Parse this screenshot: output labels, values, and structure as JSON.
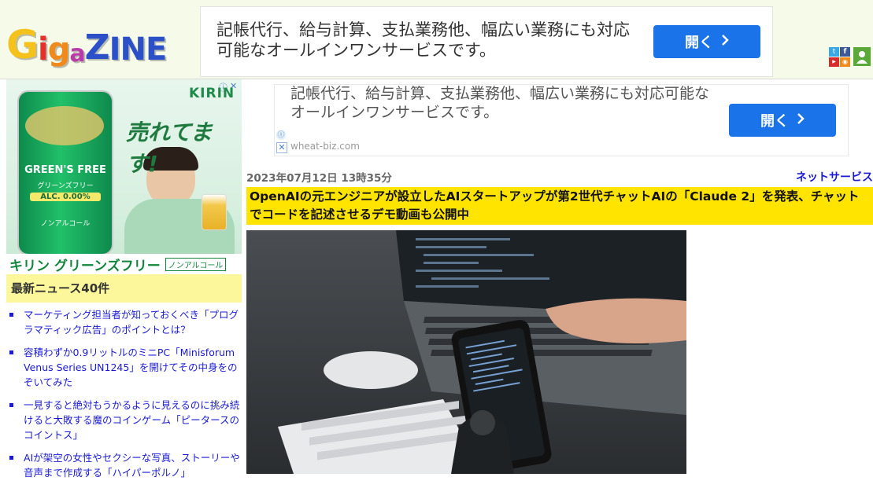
{
  "header": {
    "logo_text": "GigaZINE",
    "top_ad": {
      "text": "記帳代行、給与計算、支払業務他、幅広い業務にも対応可能なオールインワンサービスです。",
      "button_label": "開く",
      "info_glyph": "ⓘ",
      "close_glyph": "✕"
    },
    "social_icons": [
      "twitter-icon",
      "facebook-icon",
      "youtube-icon",
      "rss-icon",
      "user-icon"
    ]
  },
  "sidebar": {
    "kirin_ad": {
      "brand": "KIRIN",
      "can_line1": "GREEN'S FREE",
      "can_line2": "グリーンズフリー",
      "can_alc": "ALC. 0.00%",
      "can_bottom": "ノンアルコール",
      "headline": "売れてます!",
      "banner_main": "キリン グリーンズフリー",
      "banner_tag": "ノンアルコール",
      "info_glyph": "ⓘ",
      "close_glyph": "✕"
    },
    "news_heading": "最新ニュース40件",
    "news_items": [
      "マーケティング担当者が知っておくべき「プログラマティック広告」のポイントとは？",
      "容積わずか0.9リットルのミニPC「Minisforum Venus Series UN1245」を開けてその中身をのぞいてみた",
      "一見すると絶対もうかるように見えるのに挑み続けると大敗する魔のコインゲーム「ピータースのコイントス」",
      "AIが架空の女性やセクシーな写真、ストーリーや音声まで作成する「ハイパーポルノ」"
    ]
  },
  "main": {
    "ad": {
      "text": "記帳代行、給与計算、支払業務他、幅広い業務にも対応可能なオールインワンサービスです。",
      "button_label": "開く",
      "domain": "wheat-biz.com",
      "info_glyph": "ⓘ",
      "close_glyph": "✕"
    },
    "date": "2023年07月12日 13時35分",
    "category": "ネットサービス",
    "title": "OpenAIの元エンジニアが設立したAIスタートアップが第2世代チャットAIの「Claude 2」を発表、チャットでコードを記述させるデモ動画も公開中"
  },
  "colors": {
    "header_bg": "#f6fbe9",
    "ad_button": "#1a73e8",
    "title_bg": "#ffe400",
    "news_head_bg": "#fbf79a",
    "link": "#1a1ad6"
  }
}
